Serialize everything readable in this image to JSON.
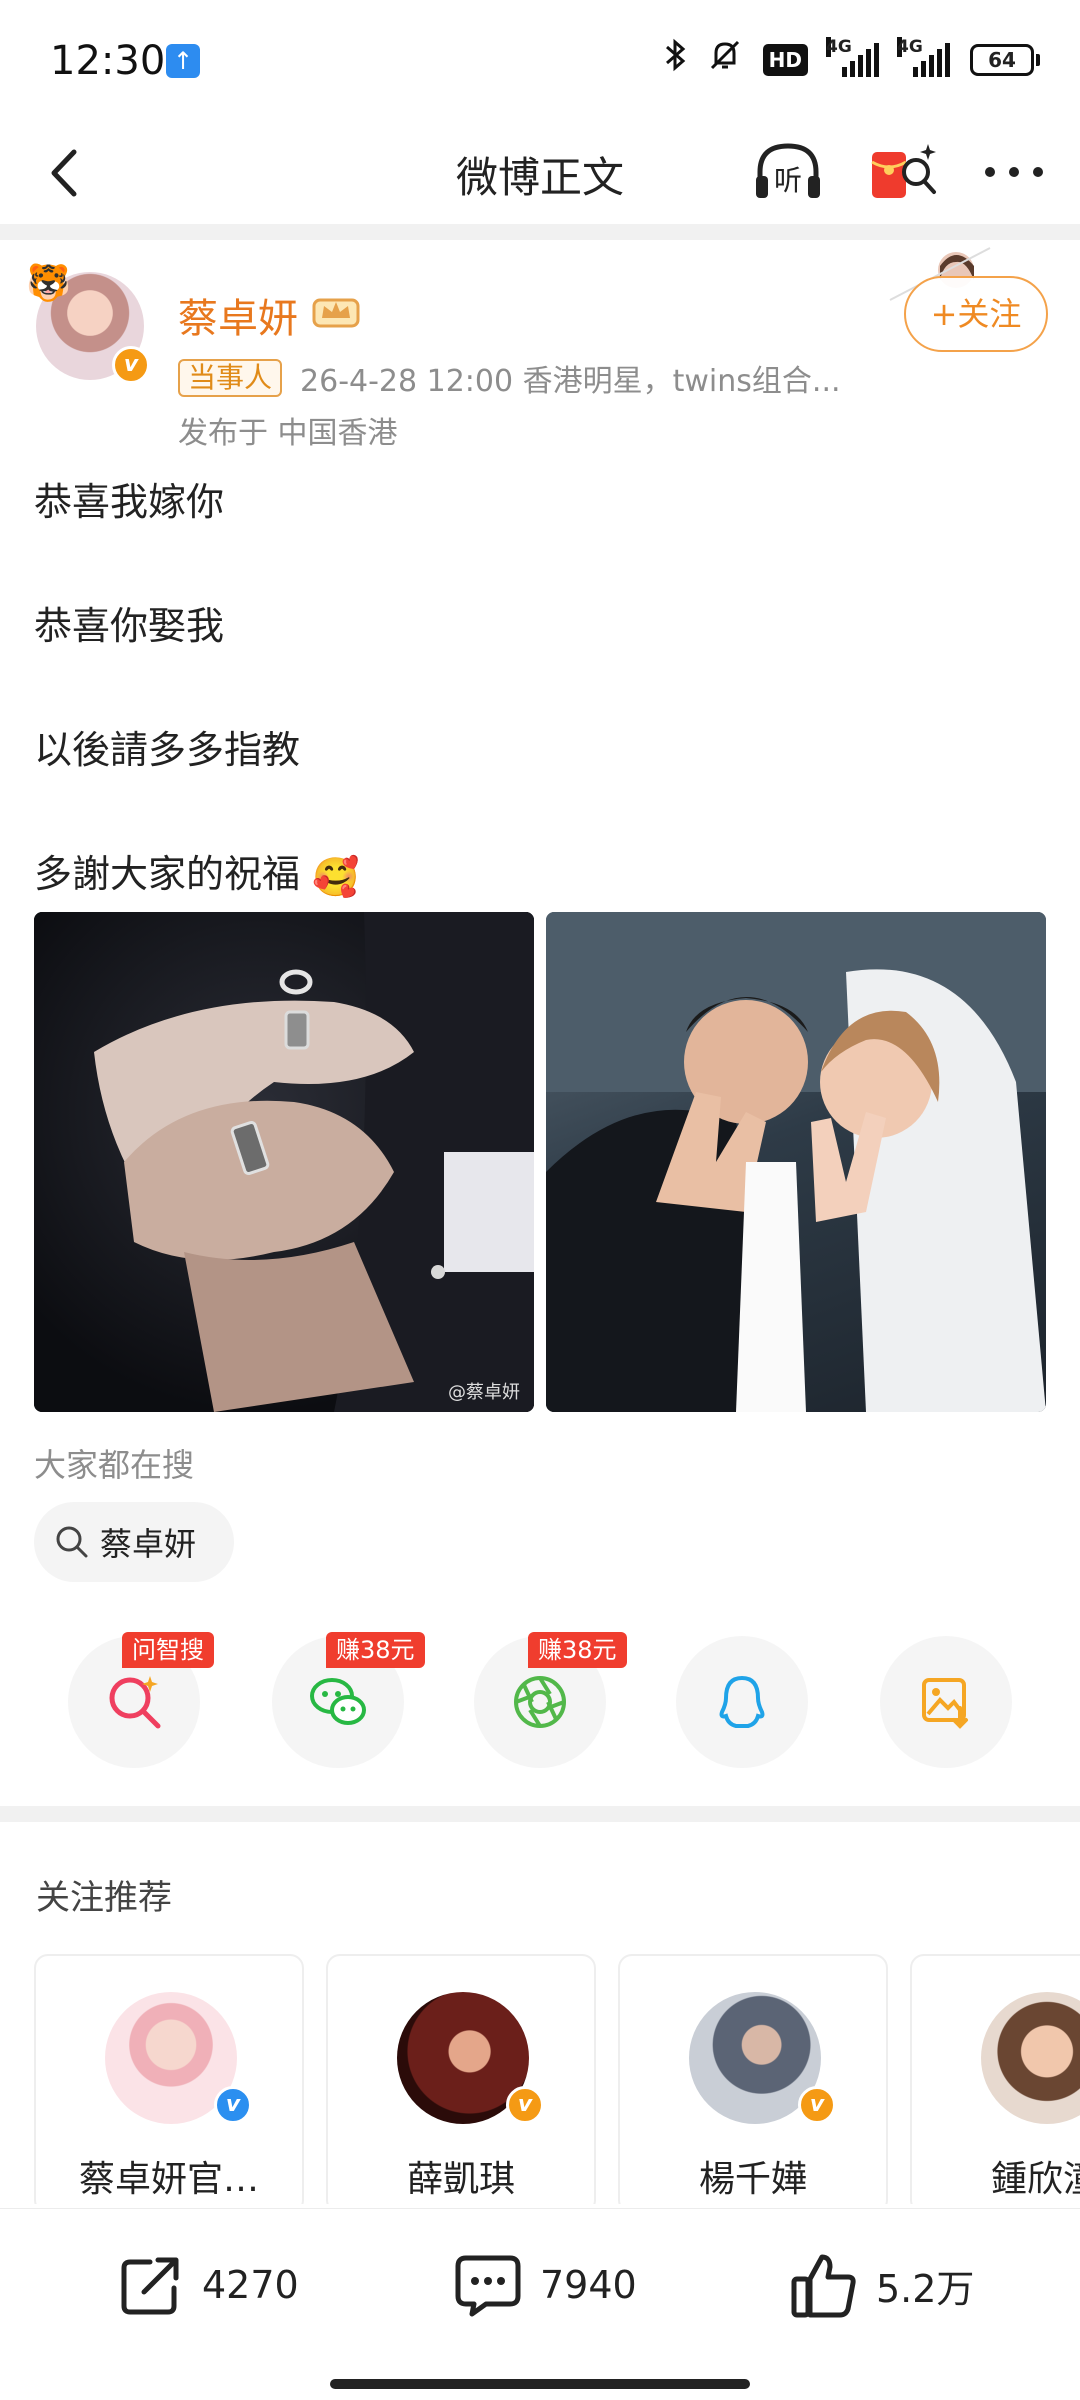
{
  "status_bar": {
    "time": "12:30",
    "hd_label": "HD",
    "signal_1": "4G",
    "signal_2": "4G",
    "battery": "64"
  },
  "nav": {
    "title": "微博正文",
    "listen_label": "听"
  },
  "post": {
    "author": "蔡卓妍",
    "party_badge": "当事人",
    "meta": "26-4-28 12:00  香港明星，twins组合...",
    "published_from": "发布于 中国香港",
    "follow_label": "+关注",
    "lines": [
      "恭喜我嫁你",
      "恭喜你娶我",
      "以後請多多指教",
      "多謝大家的祝福"
    ],
    "emoji": "🥰",
    "watermark": "@蔡卓妍"
  },
  "search": {
    "hint": "大家都在搜",
    "chip": "蔡卓妍"
  },
  "share": {
    "items": [
      {
        "icon": "ai-search-icon",
        "badge": "问智搜",
        "color": "#ef3f5f"
      },
      {
        "icon": "wechat-icon",
        "badge": "赚38元",
        "color": "#27b843"
      },
      {
        "icon": "moments-icon",
        "badge": "赚38元",
        "color": "#52b84a"
      },
      {
        "icon": "qq-icon",
        "badge": "",
        "color": "#1fa3e8"
      },
      {
        "icon": "save-image-icon",
        "badge": "",
        "color": "#f5a623"
      }
    ]
  },
  "recommend": {
    "title": "关注推荐",
    "cards": [
      {
        "name": "蔡卓妍官…",
        "badge": "blue"
      },
      {
        "name": "薛凱琪",
        "badge": "orange"
      },
      {
        "name": "楊千嬅",
        "badge": "orange"
      },
      {
        "name": "鍾欣潼",
        "badge": "orange"
      }
    ]
  },
  "actions": {
    "reposts": "4270",
    "comments": "7940",
    "likes": "5.2万"
  }
}
